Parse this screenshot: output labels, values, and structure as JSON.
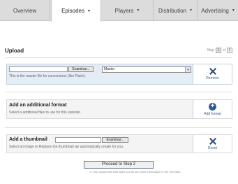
{
  "tabs": [
    {
      "label": "Overview",
      "dropdown": false,
      "active": false
    },
    {
      "label": "Episodes",
      "dropdown": true,
      "active": true
    },
    {
      "label": "Players",
      "dropdown": true,
      "active": false
    },
    {
      "label": "Distribution",
      "dropdown": true,
      "active": false
    },
    {
      "label": "Advertising",
      "dropdown": true,
      "active": false
    }
  ],
  "page": {
    "title": "Upload",
    "step_label": "Step",
    "step_current": "1",
    "step_of": "of",
    "step_total": "2"
  },
  "master": {
    "file_value": "",
    "browse_label": "Examinar...",
    "select_value": "Master",
    "hint": "This is the master file for conversions (like Flash).",
    "remove_label": "Remove"
  },
  "format": {
    "heading": "Add an additional format",
    "hint": "Select a additional files to use for this episode.",
    "add_label": "Add format"
  },
  "thumbnail": {
    "heading": "Add a thumbnail",
    "file_value": "",
    "browse_label": "Examinar...",
    "hint": "Select an image to Replace the thumbnail we automatically create for you.",
    "reset_label": "Reset"
  },
  "footer": {
    "proceed_label": "Proceed to Step 2",
    "note": "Your upload will start while you fill out some information in the next step."
  },
  "colors": {
    "accent": "#2d4a78",
    "panel_blue": "#e4ecf6"
  }
}
